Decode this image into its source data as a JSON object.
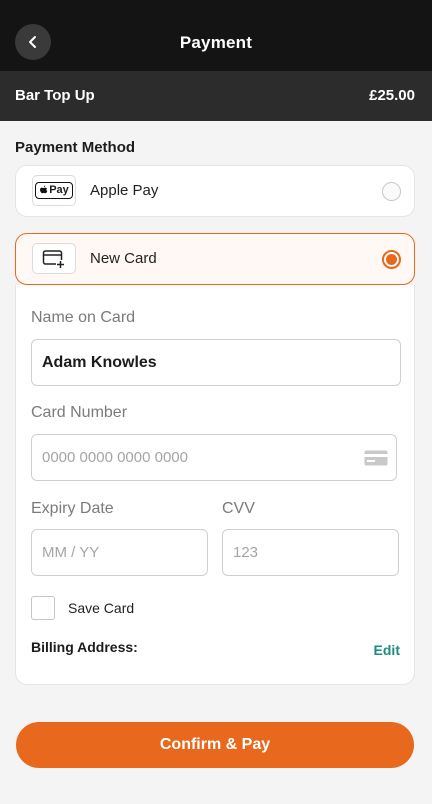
{
  "header": {
    "title": "Payment",
    "back_icon": "chevron-left-icon"
  },
  "summary": {
    "label": "Bar Top Up",
    "amount": "£25.00"
  },
  "payment_method": {
    "title": "Payment Method",
    "options": [
      {
        "label": "Apple Pay",
        "icon": "apple-pay-icon",
        "icon_text": "Pay",
        "selected": false
      },
      {
        "label": "New Card",
        "icon": "add-card-icon",
        "selected": true
      }
    ]
  },
  "card_form": {
    "name_label": "Name on Card",
    "name_value": "Adam Knowles",
    "number_label": "Card Number",
    "number_placeholder": "0000 0000 0000 0000",
    "expiry_label": "Expiry Date",
    "expiry_placeholder": "MM / YY",
    "cvv_label": "CVV",
    "cvv_placeholder": "123",
    "save_card_label": "Save Card",
    "save_card_checked": false,
    "billing_label": "Billing Address:",
    "edit_label": "Edit"
  },
  "confirm_button": {
    "label": "Confirm & Pay"
  },
  "colors": {
    "accent": "#e8681d",
    "link": "#1a8c80",
    "header_bg": "#141414",
    "summary_bg": "#2c2c2c"
  }
}
